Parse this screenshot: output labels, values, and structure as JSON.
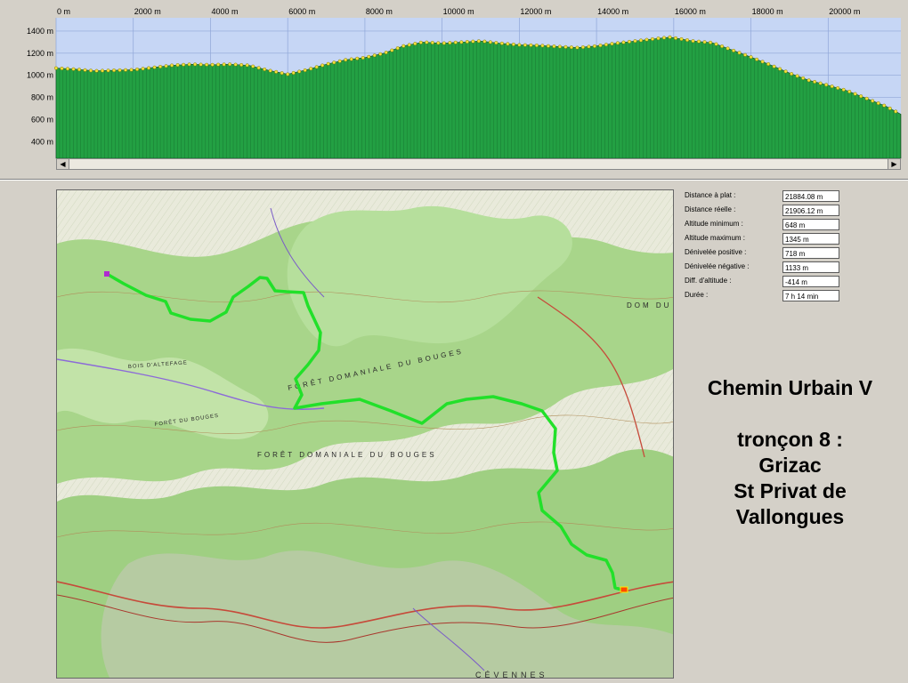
{
  "chart_data": {
    "type": "area",
    "xlabel": "",
    "ylabel": "",
    "x_ticks": [
      "0 m",
      "2000 m",
      "4000 m",
      "6000 m",
      "8000 m",
      "10000 m",
      "12000 m",
      "14000 m",
      "16000 m",
      "18000 m",
      "20000 m"
    ],
    "y_ticks": [
      "400 m",
      "600 m",
      "800 m",
      "1000 m",
      "1200 m",
      "1400 m"
    ],
    "xlim": [
      0,
      21884
    ],
    "ylim": [
      250,
      1520
    ],
    "colors": {
      "fill": "#23a043",
      "marker": "#f2e23a",
      "plot_bg": "#c6d6f5",
      "grid": "#8fa6d8"
    },
    "series": [
      {
        "x": [
          0,
          500,
          1000,
          1500,
          2000,
          2500,
          3000,
          3500,
          4000,
          4500,
          5000,
          5500,
          6000,
          6500,
          7000,
          7500,
          8000,
          8500,
          9000,
          9500,
          10000,
          10500,
          11000,
          11500,
          12000,
          12500,
          13000,
          13500,
          14000,
          14500,
          15000,
          15500,
          15900,
          16500,
          17000,
          17500,
          18000,
          18500,
          19000,
          19500,
          20000,
          20500,
          21000,
          21500,
          21884
        ],
        "y": [
          1065,
          1055,
          1040,
          1045,
          1050,
          1070,
          1090,
          1100,
          1095,
          1100,
          1090,
          1045,
          1010,
          1050,
          1100,
          1140,
          1160,
          1200,
          1265,
          1300,
          1290,
          1300,
          1310,
          1290,
          1275,
          1270,
          1260,
          1250,
          1265,
          1290,
          1310,
          1330,
          1345,
          1310,
          1295,
          1230,
          1165,
          1095,
          1020,
          955,
          910,
          860,
          790,
          720,
          648
        ]
      }
    ]
  },
  "stats": [
    {
      "label": "Distance à plat :",
      "value": "21884.08 m"
    },
    {
      "label": "Distance réelle :",
      "value": "21906.12 m"
    },
    {
      "label": "Altitude minimum :",
      "value": "648 m"
    },
    {
      "label": "Altitude maximum :",
      "value": "1345 m"
    },
    {
      "label": "Dénivelée positive :",
      "value": "718 m"
    },
    {
      "label": "Dénivelée négative :",
      "value": "1133 m"
    },
    {
      "label": "Diff. d'altitude :",
      "value": "-414 m"
    },
    {
      "label": "Durée :",
      "value": "7 h 14 min"
    }
  ],
  "caption": {
    "line1": "Chemin Urbain V",
    "line2": "tronçon 8 :",
    "line3": "Grizac",
    "line4": "St Privat de",
    "line5": "Vallongues"
  },
  "map": {
    "track_color": "#22e02a",
    "labels": [
      "FORÊT DOMANIALE DU BOUGES",
      "FORÊT DOMANIALE DU BOUGES",
      "BOIS D'ALTEFAGE",
      "FORÊT DU BOUGES",
      "DOM DU",
      "CÉVENNES"
    ]
  }
}
